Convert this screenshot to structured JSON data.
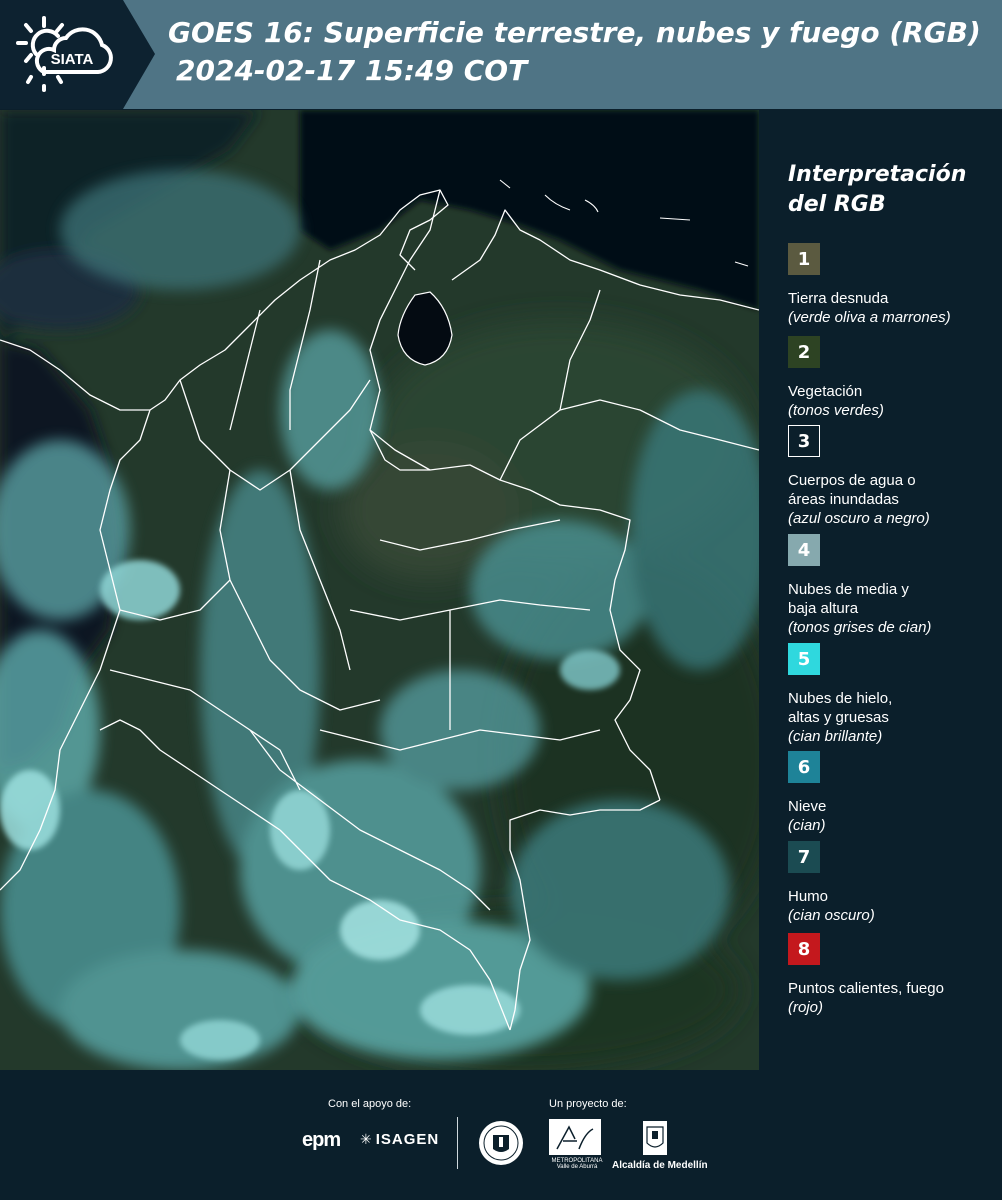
{
  "header": {
    "logo_text": "SIATA",
    "title": "GOES 16: Superficie terrestre, nubes y fuego (RGB)",
    "timestamp": "2024-02-17 15:49 COT"
  },
  "map": {
    "land_color": "#24402e",
    "cloud_color": "#6fc3c6",
    "water_color": "#07111a",
    "border_color": "#ffffff"
  },
  "legend": {
    "title": "Interpretación del RGB",
    "items": [
      {
        "number": "1",
        "color": "#5b5a40",
        "name": "Tierra desnuda",
        "desc": "(verde oliva a marrones)"
      },
      {
        "number": "2",
        "color": "#2d4323",
        "name": "Vegetación",
        "desc": "(tonos verdes)"
      },
      {
        "number": "3",
        "color": "#0b1f2b",
        "name": "Cuerpos de agua o áreas inundadas",
        "desc": "(azul oscuro a negro)"
      },
      {
        "number": "4",
        "color": "#86a9ae",
        "name": "Nubes de media y baja altura",
        "desc": "(tonos grises de cian)"
      },
      {
        "number": "5",
        "color": "#2fd8de",
        "name": "Nubes de hielo, altas y gruesas",
        "desc": "(cian brillante)"
      },
      {
        "number": "6",
        "color": "#1e8398",
        "name": "Nieve",
        "desc": "(cian)"
      },
      {
        "number": "7",
        "color": "#1b4b52",
        "name": "Humo",
        "desc": "(cian oscuro)"
      },
      {
        "number": "8",
        "color": "#c4181d",
        "name": "Puntos calientes, fuego",
        "desc": "(rojo)"
      }
    ]
  },
  "footer": {
    "support_label": "Con el apoyo de:",
    "project_label": "Un proyecto de:",
    "epm": "epm",
    "isagen": "ISAGEN",
    "area_metropolitana": "METROPOLITANA Valle de Aburrá",
    "alcaldia": "Alcaldía de Medellín"
  }
}
